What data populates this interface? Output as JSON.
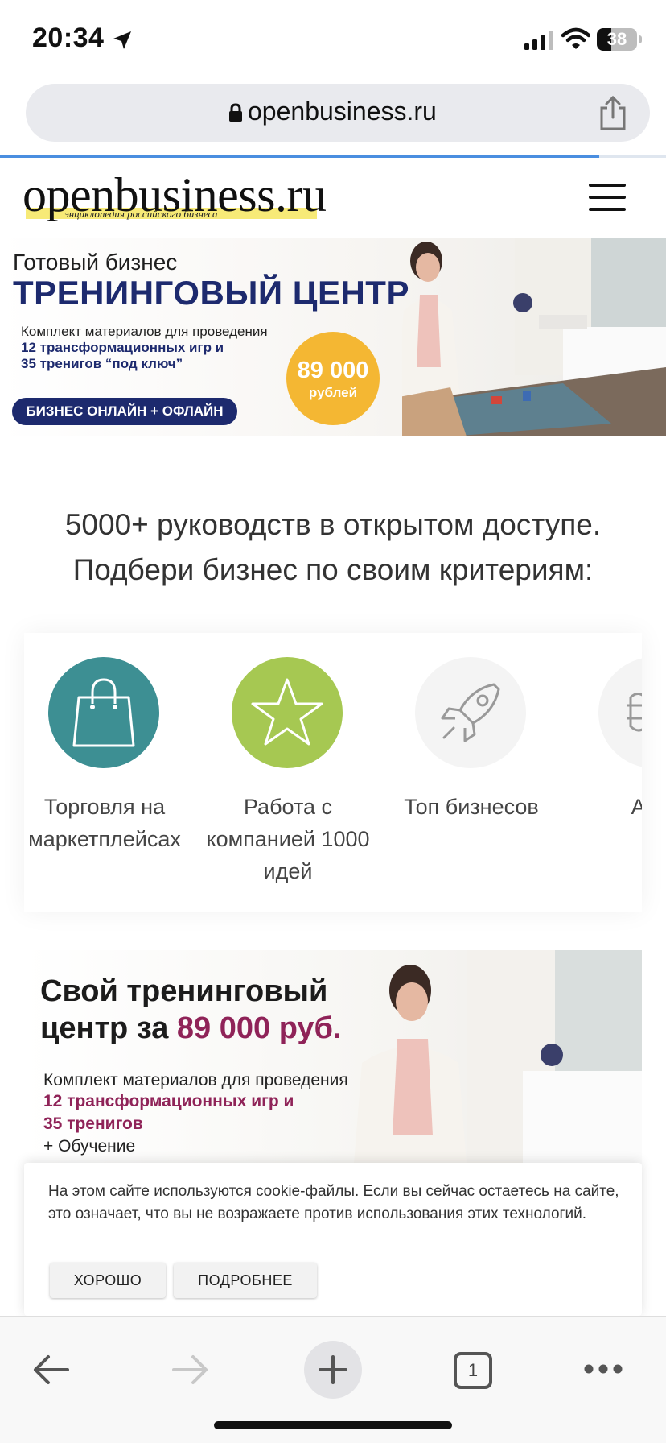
{
  "status_bar": {
    "time": "20:34",
    "battery": "38"
  },
  "browser": {
    "url": "openbusiness.ru",
    "tabs_count": "1"
  },
  "site": {
    "logo": "openbusiness.ru",
    "tagline": "энциклопедия российского бизнеса"
  },
  "banner_top": {
    "subtitle": "Готовый бизнес",
    "title": "ТРЕНИНГОВЫЙ ЦЕНТР",
    "line1": "Комплект материалов для проведения",
    "line2": "12 трансформационных игр и",
    "line3": "35 тренигов “под ключ”",
    "pill": "БИЗНЕС ОНЛАЙН + ОФЛАЙН",
    "price": "89 000",
    "price_unit": "рублей"
  },
  "headline": {
    "line1": "5000+ руководств в открытом доступе.",
    "line2": "Подбери бизнес по своим критериям:"
  },
  "categories": [
    {
      "label": "Торговля на маркетплейсах",
      "icon": "shopping-bag-icon",
      "color": "#3d8f93"
    },
    {
      "label": "Работа с компанией 1000 идей",
      "icon": "star-icon",
      "color": "#a6c852"
    },
    {
      "label": "Топ бизнесов",
      "icon": "rocket-icon",
      "color": "#f4f4f4"
    },
    {
      "label": "Авто",
      "icon": "car-icon",
      "color": "#f4f4f4"
    }
  ],
  "banner_bottom": {
    "title_line1": "Свой тренинговый",
    "title_line2_prefix": "центр за ",
    "title_price": "89 000 руб.",
    "line1": "Комплект материалов для проведения",
    "line2": "12 трансформационных игр и",
    "line3": "35 тренигов",
    "line4": "+ Обучение"
  },
  "cookie": {
    "text": "На этом сайте используются cookie-файлы. Если вы сейчас остаетесь на сайте, это означает, что вы не возражаете против использования этих технологий.",
    "ok_label": "ХОРОШО",
    "more_label": "ПОДРОБНЕЕ"
  },
  "colors": {
    "navy": "#1d2a6e",
    "price_yellow": "#f4b733",
    "wine": "#8f2358",
    "teal": "#3d8f93",
    "lime": "#a6c852",
    "progress_blue": "#4a8ee0"
  }
}
